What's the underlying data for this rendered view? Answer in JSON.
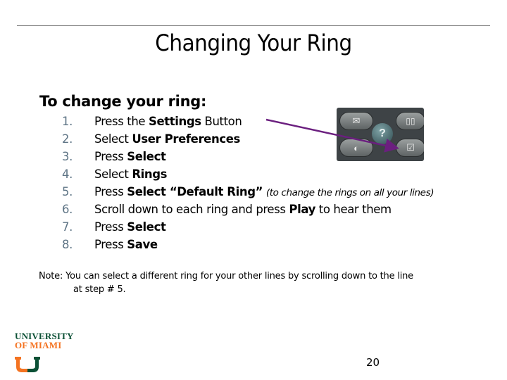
{
  "slide": {
    "title": "Changing Your Ring",
    "subheading": "To change your ring:",
    "steps": [
      {
        "num": "1.",
        "parts": [
          {
            "t": "Press the ",
            "s": "normal"
          },
          {
            "t": "Settings",
            "s": "bold"
          },
          {
            "t": " Button",
            "s": "normal"
          }
        ]
      },
      {
        "num": "2.",
        "parts": [
          {
            "t": "Select ",
            "s": "normal"
          },
          {
            "t": "User Preferences",
            "s": "bold"
          }
        ]
      },
      {
        "num": "3.",
        "parts": [
          {
            "t": "Press ",
            "s": "normal"
          },
          {
            "t": "Select",
            "s": "bold"
          }
        ]
      },
      {
        "num": "4.",
        "parts": [
          {
            "t": "Select ",
            "s": "normal"
          },
          {
            "t": "Rings",
            "s": "bold"
          }
        ]
      },
      {
        "num": "5.",
        "parts": [
          {
            "t": "Press ",
            "s": "normal"
          },
          {
            "t": "Select “Default Ring”",
            "s": "bold"
          },
          {
            "t": " ",
            "s": "normal"
          },
          {
            "t": "(to change the rings on all your lines)",
            "s": "italic"
          }
        ]
      },
      {
        "num": "6.",
        "parts": [
          {
            "t": "Scroll down to each ring and press ",
            "s": "normal"
          },
          {
            "t": "Play",
            "s": "bold"
          },
          {
            "t": " to hear them",
            "s": "normal"
          }
        ]
      },
      {
        "num": "7.",
        "parts": [
          {
            "t": "Press ",
            "s": "normal"
          },
          {
            "t": "Select",
            "s": "bold"
          }
        ]
      },
      {
        "num": "8.",
        "parts": [
          {
            "t": "Press ",
            "s": "normal"
          },
          {
            "t": "Save",
            "s": "bold"
          }
        ]
      }
    ],
    "note_line1": "Note:  You can select a different ring for your other lines by scrolling down to the line",
    "note_line2": "at step # 5.",
    "page_number": "20"
  },
  "phone_image": {
    "buttons": [
      {
        "name": "messages-button",
        "icon": "envelope-icon",
        "glyph": "✉"
      },
      {
        "name": "directories-button",
        "icon": "book-icon",
        "glyph": "🕮"
      },
      {
        "name": "help-button",
        "icon": "question-icon",
        "glyph": "?"
      },
      {
        "name": "services-button",
        "icon": "globe-icon",
        "glyph": "◐"
      },
      {
        "name": "settings-button",
        "icon": "settings-checkbox-icon",
        "glyph": "☑"
      }
    ]
  },
  "logo": {
    "line1": "UNIVERSITY",
    "line2": "OF MIAMI"
  },
  "colors": {
    "number_color": "#5f7586",
    "arrow_color": "#6b1f7f",
    "um_green": "#0b5035",
    "um_orange": "#f47321",
    "rule_color": "#808080"
  }
}
